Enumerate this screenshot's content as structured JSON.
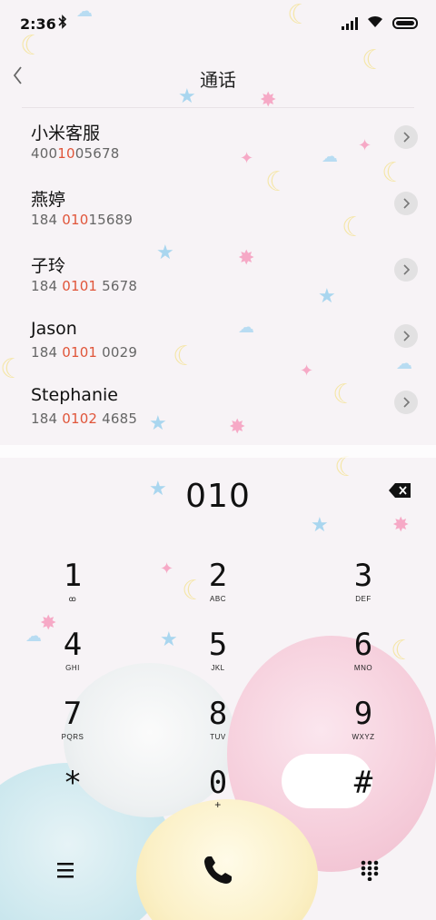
{
  "status_bar": {
    "time": "2:36",
    "icons": [
      "bluetooth-icon",
      "signal-icon",
      "wifi-icon",
      "battery-icon"
    ]
  },
  "header": {
    "title": "通话",
    "back_icon": "chevron-left-icon"
  },
  "contacts": [
    {
      "name": "小米客服",
      "number_pre": "400",
      "number_match": "10",
      "number_post": "05678"
    },
    {
      "name": "燕婷",
      "number_pre": "184 ",
      "number_match": "010",
      "number_post": "15689"
    },
    {
      "name": "子玲",
      "number_pre": "184 ",
      "number_match": "0101",
      "number_post": " 5678"
    },
    {
      "name": "Jason",
      "number_pre": "184 ",
      "number_match": "0101",
      "number_post": " 0029"
    },
    {
      "name": "Stephanie",
      "number_pre": "184 ",
      "number_match": "0102",
      "number_post": " 4685"
    }
  ],
  "dialer": {
    "input": "010",
    "keys": [
      {
        "digit": "1",
        "letters": "ꝏ"
      },
      {
        "digit": "2",
        "letters": "ABC"
      },
      {
        "digit": "3",
        "letters": "DEF"
      },
      {
        "digit": "4",
        "letters": "GHI"
      },
      {
        "digit": "5",
        "letters": "JKL"
      },
      {
        "digit": "6",
        "letters": "MNO"
      },
      {
        "digit": "7",
        "letters": "PQRS"
      },
      {
        "digit": "8",
        "letters": "TUV"
      },
      {
        "digit": "9",
        "letters": "WXYZ"
      },
      {
        "digit": "*",
        "letters": ""
      },
      {
        "digit": "0",
        "letters": "+"
      },
      {
        "digit": "#",
        "letters": ""
      }
    ]
  },
  "bottom_bar": {
    "icons": [
      "menu-icon",
      "phone-call-icon",
      "dialpad-grid-icon"
    ]
  },
  "colors": {
    "highlight": "#e0553a",
    "background": "#f7f3f6"
  }
}
